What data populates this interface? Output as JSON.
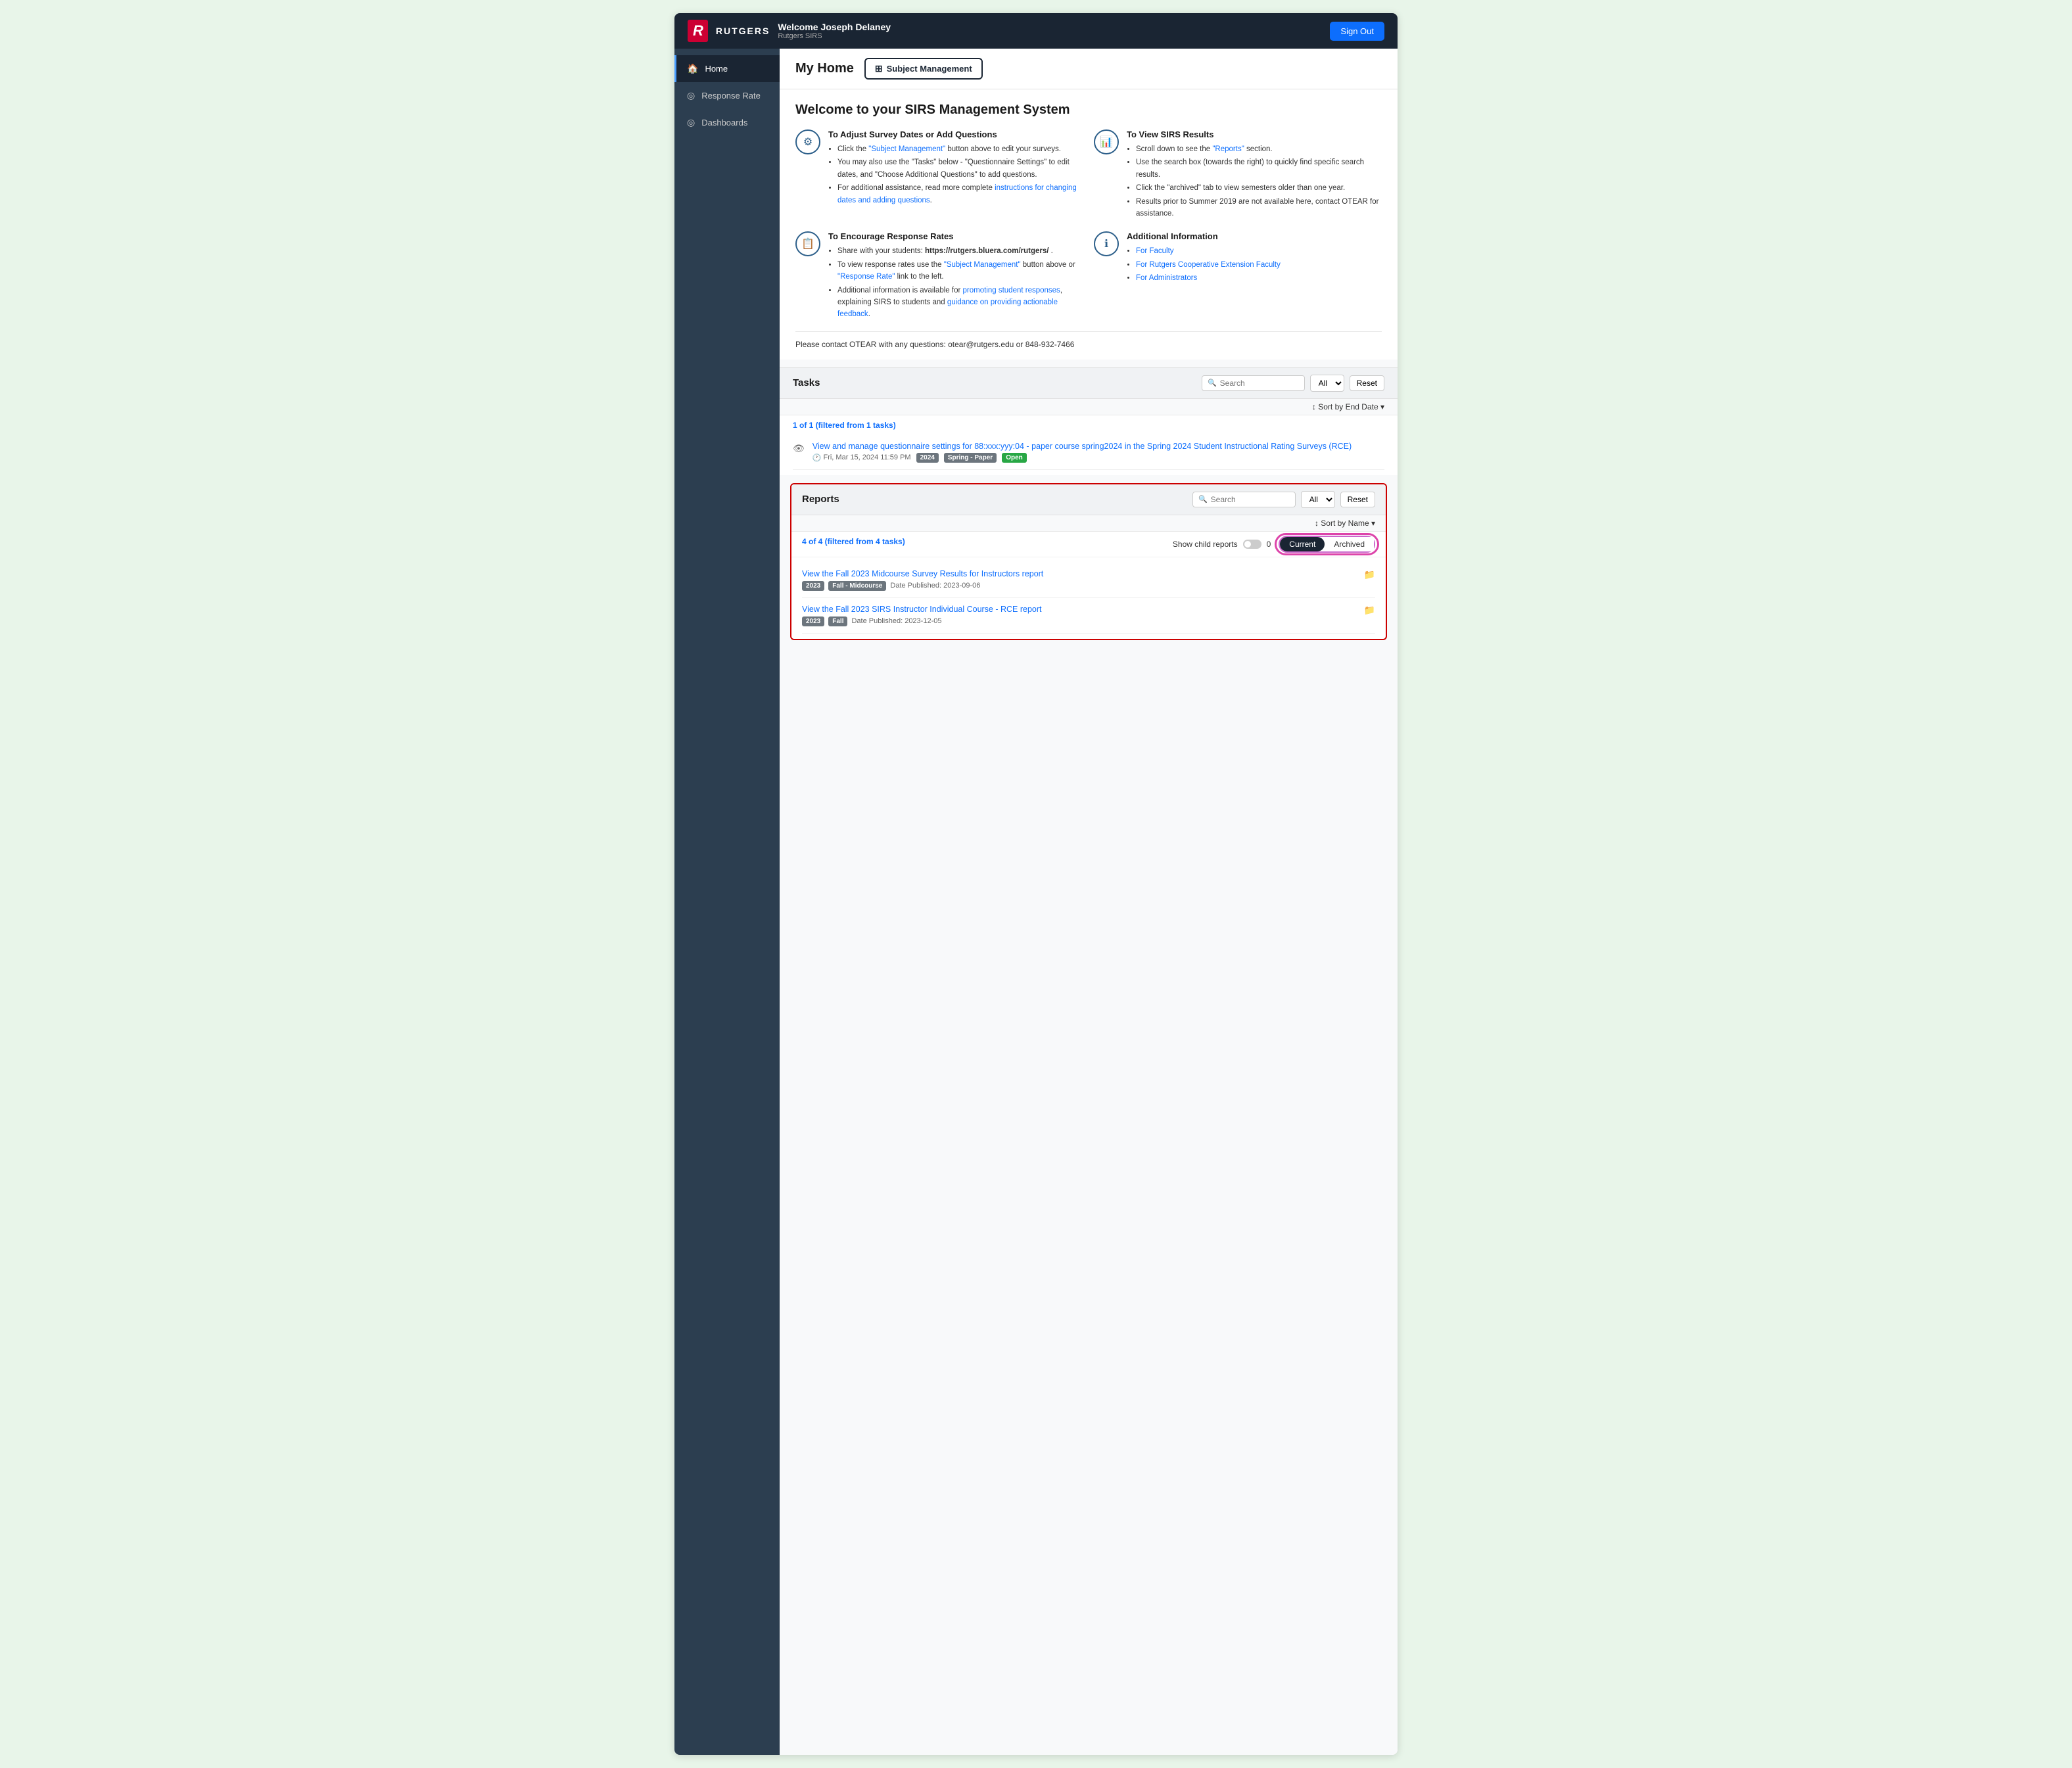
{
  "header": {
    "welcome": "Welcome Joseph Delaney",
    "system": "Rutgers SIRS",
    "sign_out": "Sign Out",
    "logo_r": "R",
    "logo_text": "RUTGERS"
  },
  "sidebar": {
    "items": [
      {
        "id": "home",
        "label": "Home",
        "icon": "🏠",
        "active": true
      },
      {
        "id": "response-rate",
        "label": "Response Rate",
        "icon": "⊙"
      },
      {
        "id": "dashboards",
        "label": "Dashboards",
        "icon": "⊙"
      }
    ]
  },
  "page": {
    "title": "My Home",
    "subject_mgmt_btn": "Subject Management"
  },
  "welcome": {
    "title": "Welcome to your SIRS Management System",
    "cards": [
      {
        "id": "adjust-survey",
        "icon": "⚙",
        "heading": "To Adjust Survey Dates or Add Questions",
        "bullets": [
          "Click the \"Subject Management\" button above to edit your surveys.",
          "You may also use the \"Tasks\" below - \"Questionnaire Settings\" to edit dates, and \"Choose Additional Questions\" to add questions.",
          "For additional assistance, read more complete instructions for changing dates and adding questions."
        ]
      },
      {
        "id": "view-sirs",
        "icon": "📊",
        "heading": "To View SIRS Results",
        "bullets": [
          "Scroll down to see the \"Reports\" section.",
          "Use the search box (towards the right) to quickly find specific search results.",
          "Click the \"archived\" tab to view semesters older than one year.",
          "Results prior to Summer 2019 are not available here, contact OTEAR for assistance."
        ]
      },
      {
        "id": "encourage",
        "icon": "📋",
        "heading": "To Encourage Response Rates",
        "bullets": [
          "Share with your students: https://rutgers.bluera.com/rutgers/ .",
          "To view response rates use the \"Subject Management\" button above or \"Response Rate\" link to the left.",
          "Additional information is available for promoting student responses, explaining SIRS to students and guidance on providing actionable feedback."
        ]
      },
      {
        "id": "additional-info",
        "icon": "ℹ",
        "heading": "Additional Information",
        "links": [
          "For Faculty",
          "For Rutgers Cooperative Extension Faculty",
          "For Administrators"
        ]
      }
    ],
    "contact": "Please contact OTEAR with any questions: otear@rutgers.edu or 848-932-7466"
  },
  "tasks": {
    "title": "Tasks",
    "search_placeholder": "Search",
    "all_label": "All ▾",
    "reset_label": "Reset",
    "sort_label": "↕ Sort by End Date ▾",
    "filter_count": "1 of 1 (filtered from 1 tasks)",
    "items": [
      {
        "id": "task-1",
        "link_text": "View and manage questionnaire settings for 88:xxx:yyy:04 - paper course spring2024 in the Spring 2024 Student Instructional Rating Surveys (RCE)",
        "date": "Fri, Mar 15, 2024 11:59 PM",
        "tags": [
          "2024",
          "Spring - Paper",
          "Open"
        ]
      }
    ]
  },
  "reports": {
    "title": "Reports",
    "search_placeholder": "Search",
    "all_label": "All ▾",
    "reset_label": "Reset",
    "sort_label": "↕ Sort by Name ▾",
    "filter_count": "4 of 4 (filtered from 4 tasks)",
    "show_child_reports": "Show child reports",
    "current_label": "Current",
    "archived_label": "Archived",
    "items": [
      {
        "id": "report-1",
        "link_text": "View the Fall 2023 Midcourse Survey Results for Instructors report",
        "tags": [
          "2023",
          "Fall - Midcourse"
        ],
        "date_published": "Date Published: 2023-09-06"
      },
      {
        "id": "report-2",
        "link_text": "View the Fall 2023 SIRS Instructor Individual Course - RCE report",
        "tags": [
          "2023",
          "Fall"
        ],
        "date_published": "Date Published: 2023-12-05"
      }
    ]
  }
}
